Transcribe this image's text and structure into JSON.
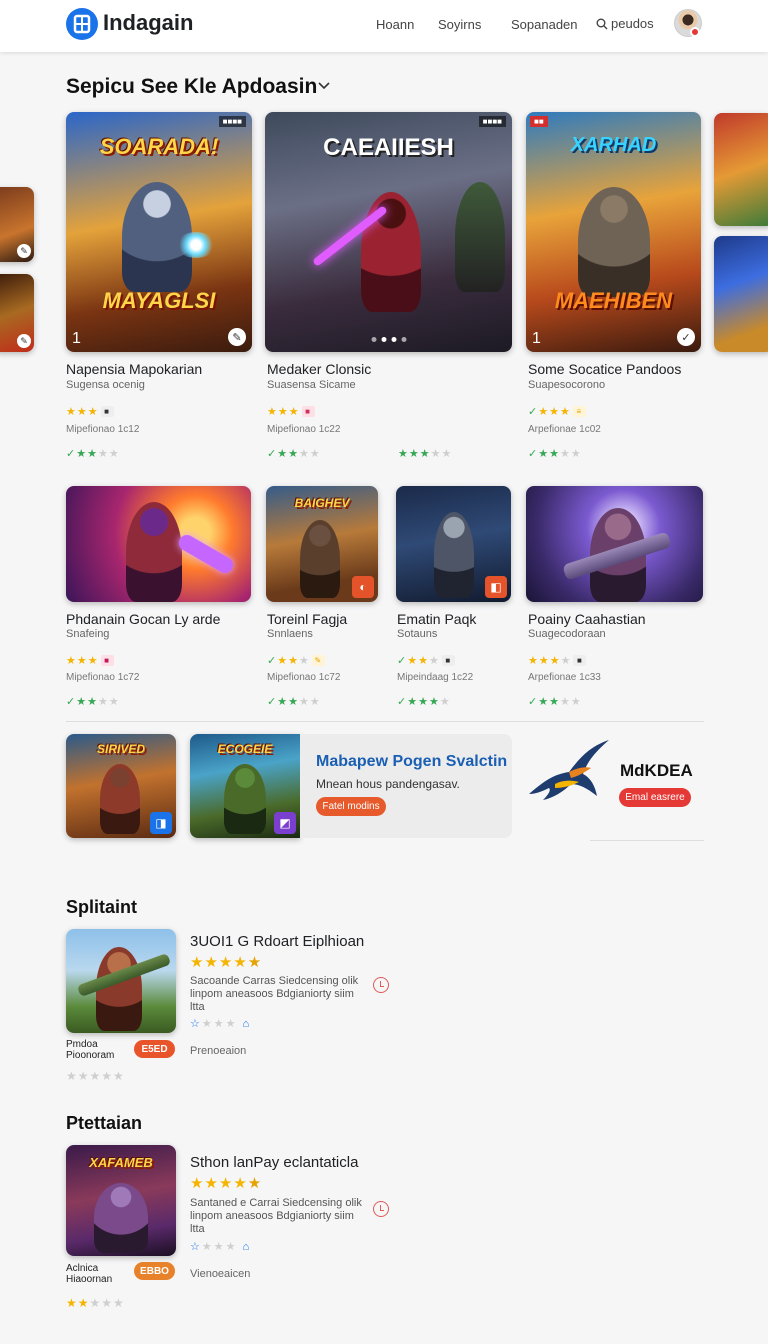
{
  "header": {
    "brand": "Indagain",
    "nav": [
      "Hoann",
      "Soyirns",
      "Sopanaden"
    ],
    "search_label": "peudos"
  },
  "section": {
    "title": "Sepicu See Kle Apdoasin"
  },
  "featured": [
    {
      "art_top": "SOARADA!",
      "art_bottom": "MAYAGLSI",
      "number": "1",
      "title": "Napensia Mapokarian",
      "subtitle": "Sugensa ocenig",
      "meta": "Mipefionao 1c12"
    },
    {
      "art_top": "CAEAIIESH",
      "title": "Medaker Clonsic",
      "subtitle": "Suasensa Sicame",
      "meta": "Mipefionao 1c22"
    },
    {
      "art_top": "XARHAD",
      "art_bottom": "MAEHIBEN",
      "number": "1",
      "title": "Some Socatice Pandoos",
      "subtitle": "Suapesocorono",
      "meta": "Arpefionae 1c02"
    }
  ],
  "games": [
    {
      "title": "Phdanain Gocan Ly arde",
      "subtitle": "Snafeing",
      "meta": "Mipefionao 1c72"
    },
    {
      "art_top": "BAIGHEV",
      "title": "Toreinl Fagja",
      "subtitle": "Snnlaens",
      "meta": "Mipefionao 1c72"
    },
    {
      "title": "Ematin Paqk",
      "subtitle": "Sotauns",
      "meta": "Mipeindaag 1c22"
    },
    {
      "title": "Poainy Caahastian",
      "subtitle": "Suagecodoraan",
      "meta": "Arpefionae 1c33"
    }
  ],
  "promo": {
    "tile1_art": "SIRIVED",
    "tile2_art": "ECOGEIE",
    "title": "Mabapew Pogen Svalctin",
    "description": "Mnean hous pandengasav.",
    "button": "Fatel modins",
    "brand": "MdKDEA",
    "brand_button": "Emal easrere"
  },
  "lists": [
    {
      "heading": "Splitaint",
      "title": "3UOI1 G Rdoart Eiplhioan",
      "description": "Sacoande Carras Siedcensing olik linpom aneasoos Bdgianiorty siim ltta",
      "meta": "Prenoeaion",
      "name": "Pmdoa Pioonoram",
      "button": "E5ED",
      "button_color": "#e8552a"
    },
    {
      "heading": "Ptettaian",
      "art": "XAFAMEB",
      "title": "Sthon lanPay eclantaticla",
      "description": "Santaned e Carrai Siedcensing olik linpom aneasoos Bdgianiorty siim ltta",
      "meta": "Vienoeaicen",
      "name": "Aclnica Hiaoornan",
      "button": "EBBO",
      "button_color": "#e8822a"
    }
  ],
  "colors": {
    "accent": "#1a73e8",
    "promo_title": "#1a5fb4",
    "orange": "#e65a2b",
    "red": "#e53935",
    "star": "#f4b400",
    "green": "#34a853"
  }
}
